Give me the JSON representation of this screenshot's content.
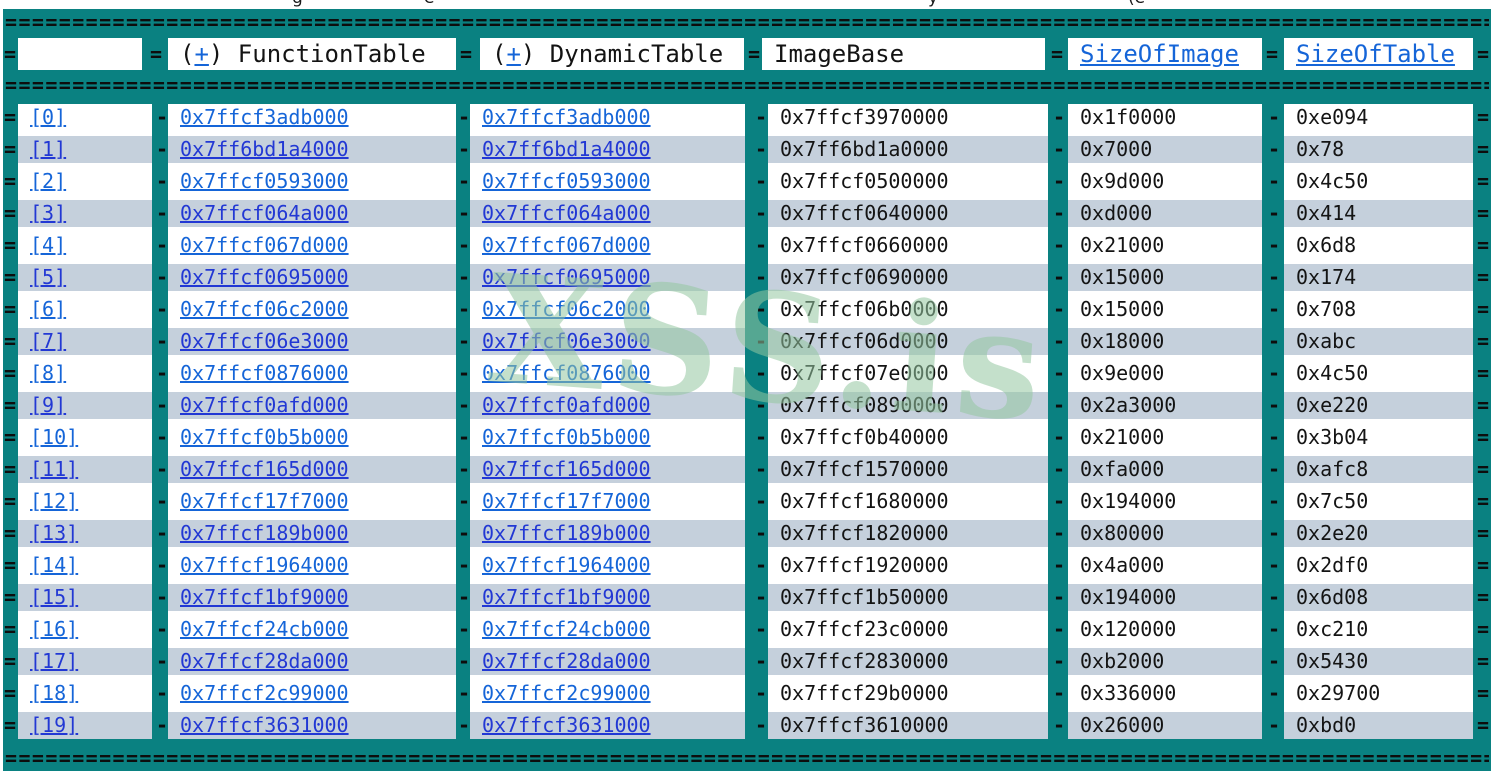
{
  "watermark": {
    "text": "XSS.is"
  },
  "top_clipped_fragments": [
    "g",
    "e",
    "y",
    "(e"
  ],
  "colors": {
    "background_teal": "#0A8181",
    "row_band_gray": "#C5D0DC",
    "row_band_white": "#FFFFFF",
    "link_blue_on_white": "#1565D8",
    "link_blue_on_gray": "#2238D4",
    "text_black": "#141414",
    "watermark_green": "#94C6A0"
  },
  "borders": {
    "horizontal_char": "=",
    "horizontal_repeat": 114,
    "row_edge_char": "=",
    "cell_separator_char": "-",
    "header_separator_char": "="
  },
  "header": {
    "cells": [
      {
        "text": ""
      },
      {
        "pre": "(",
        "expand": "+",
        "post": ") FunctionTable"
      },
      {
        "pre": "(",
        "expand": "+",
        "post": ") DynamicTable"
      },
      {
        "text": "ImageBase"
      },
      {
        "text": "SizeOfImage"
      },
      {
        "text": "SizeOfTable"
      }
    ]
  },
  "table": {
    "columns": [
      "index",
      "FunctionTable",
      "DynamicTable",
      "ImageBase",
      "SizeOfImage",
      "SizeOfTable"
    ],
    "rows": [
      {
        "index": "[0]",
        "function_table": "0x7ffcf3adb000",
        "dynamic_table": "0x7ffcf3adb000",
        "image_base": "0x7ffcf3970000",
        "size_of_image": "0x1f0000",
        "size_of_table": "0xe094"
      },
      {
        "index": "[1]",
        "function_table": "0x7ff6bd1a4000",
        "dynamic_table": "0x7ff6bd1a4000",
        "image_base": "0x7ff6bd1a0000",
        "size_of_image": "0x7000",
        "size_of_table": "0x78"
      },
      {
        "index": "[2]",
        "function_table": "0x7ffcf0593000",
        "dynamic_table": "0x7ffcf0593000",
        "image_base": "0x7ffcf0500000",
        "size_of_image": "0x9d000",
        "size_of_table": "0x4c50"
      },
      {
        "index": "[3]",
        "function_table": "0x7ffcf064a000",
        "dynamic_table": "0x7ffcf064a000",
        "image_base": "0x7ffcf0640000",
        "size_of_image": "0xd000",
        "size_of_table": "0x414"
      },
      {
        "index": "[4]",
        "function_table": "0x7ffcf067d000",
        "dynamic_table": "0x7ffcf067d000",
        "image_base": "0x7ffcf0660000",
        "size_of_image": "0x21000",
        "size_of_table": "0x6d8"
      },
      {
        "index": "[5]",
        "function_table": "0x7ffcf0695000",
        "dynamic_table": "0x7ffcf0695000",
        "image_base": "0x7ffcf0690000",
        "size_of_image": "0x15000",
        "size_of_table": "0x174"
      },
      {
        "index": "[6]",
        "function_table": "0x7ffcf06c2000",
        "dynamic_table": "0x7ffcf06c2000",
        "image_base": "0x7ffcf06b0000",
        "size_of_image": "0x15000",
        "size_of_table": "0x708"
      },
      {
        "index": "[7]",
        "function_table": "0x7ffcf06e3000",
        "dynamic_table": "0x7ffcf06e3000",
        "image_base": "0x7ffcf06d0000",
        "size_of_image": "0x18000",
        "size_of_table": "0xabc"
      },
      {
        "index": "[8]",
        "function_table": "0x7ffcf0876000",
        "dynamic_table": "0x7ffcf0876000",
        "image_base": "0x7ffcf07e0000",
        "size_of_image": "0x9e000",
        "size_of_table": "0x4c50"
      },
      {
        "index": "[9]",
        "function_table": "0x7ffcf0afd000",
        "dynamic_table": "0x7ffcf0afd000",
        "image_base": "0x7ffcf0890000",
        "size_of_image": "0x2a3000",
        "size_of_table": "0xe220"
      },
      {
        "index": "[10]",
        "function_table": "0x7ffcf0b5b000",
        "dynamic_table": "0x7ffcf0b5b000",
        "image_base": "0x7ffcf0b40000",
        "size_of_image": "0x21000",
        "size_of_table": "0x3b04"
      },
      {
        "index": "[11]",
        "function_table": "0x7ffcf165d000",
        "dynamic_table": "0x7ffcf165d000",
        "image_base": "0x7ffcf1570000",
        "size_of_image": "0xfa000",
        "size_of_table": "0xafc8"
      },
      {
        "index": "[12]",
        "function_table": "0x7ffcf17f7000",
        "dynamic_table": "0x7ffcf17f7000",
        "image_base": "0x7ffcf1680000",
        "size_of_image": "0x194000",
        "size_of_table": "0x7c50"
      },
      {
        "index": "[13]",
        "function_table": "0x7ffcf189b000",
        "dynamic_table": "0x7ffcf189b000",
        "image_base": "0x7ffcf1820000",
        "size_of_image": "0x80000",
        "size_of_table": "0x2e20"
      },
      {
        "index": "[14]",
        "function_table": "0x7ffcf1964000",
        "dynamic_table": "0x7ffcf1964000",
        "image_base": "0x7ffcf1920000",
        "size_of_image": "0x4a000",
        "size_of_table": "0x2df0"
      },
      {
        "index": "[15]",
        "function_table": "0x7ffcf1bf9000",
        "dynamic_table": "0x7ffcf1bf9000",
        "image_base": "0x7ffcf1b50000",
        "size_of_image": "0x194000",
        "size_of_table": "0x6d08"
      },
      {
        "index": "[16]",
        "function_table": "0x7ffcf24cb000",
        "dynamic_table": "0x7ffcf24cb000",
        "image_base": "0x7ffcf23c0000",
        "size_of_image": "0x120000",
        "size_of_table": "0xc210"
      },
      {
        "index": "[17]",
        "function_table": "0x7ffcf28da000",
        "dynamic_table": "0x7ffcf28da000",
        "image_base": "0x7ffcf2830000",
        "size_of_image": "0xb2000",
        "size_of_table": "0x5430"
      },
      {
        "index": "[18]",
        "function_table": "0x7ffcf2c99000",
        "dynamic_table": "0x7ffcf2c99000",
        "image_base": "0x7ffcf29b0000",
        "size_of_image": "0x336000",
        "size_of_table": "0x29700"
      },
      {
        "index": "[19]",
        "function_table": "0x7ffcf3631000",
        "dynamic_table": "0x7ffcf3631000",
        "image_base": "0x7ffcf3610000",
        "size_of_image": "0x26000",
        "size_of_table": "0xbd0"
      }
    ]
  }
}
